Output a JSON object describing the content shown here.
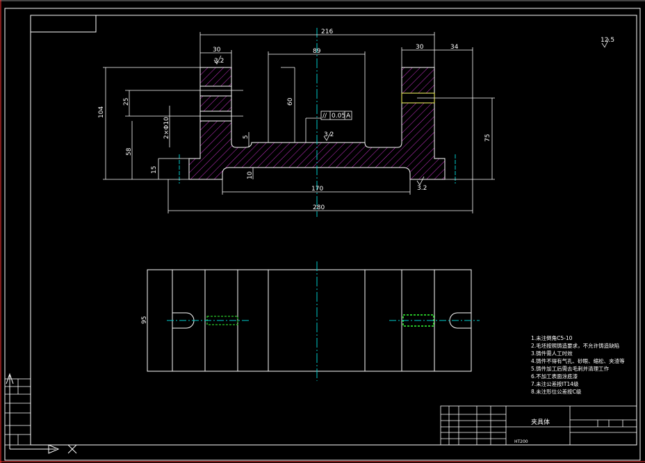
{
  "drawing": {
    "title": "夹具体",
    "material": "HT200",
    "surface_roughness": "12.5",
    "roughness_marks": [
      "3.2",
      "3.2",
      "3.2"
    ],
    "tolerance_frame": {
      "symbol": "//",
      "value": "0.05",
      "datum": "A"
    }
  },
  "colors": {
    "background": "#000000",
    "line": "#ffffff",
    "hatch": "#cc33cc",
    "center_line": "#00cccc",
    "green": "#33ff33",
    "yellow": "#ffff66",
    "frame_red": "#ff3333"
  },
  "dimensions": {
    "overall_top": "216",
    "left_column": "30",
    "right_column": "30",
    "right_offset": "34",
    "slot": "89",
    "total_height": "104",
    "hole_spacing": "25",
    "hole_dia": "2×Φ10",
    "lower_height": "58",
    "base": "15",
    "inner_depth": "60",
    "right_height": "75",
    "step": "5",
    "recess": "10",
    "bottom_inner": "170",
    "bottom_overall": "280",
    "plan_width": "95"
  },
  "notes": [
    "1.未注倒角C5-10",
    "2.毛坯按照铸造要求，不允许铸造缺陷",
    "3.铸件需人工时效",
    "4.铸件不得有气孔、砂眼、缩松、夹渣等",
    "5.铸件加工后需去毛刺并清理工作",
    "6.不加工表面涂底漆",
    "7.未注公差按IT14级",
    "8.未注形位公差按C级"
  ]
}
